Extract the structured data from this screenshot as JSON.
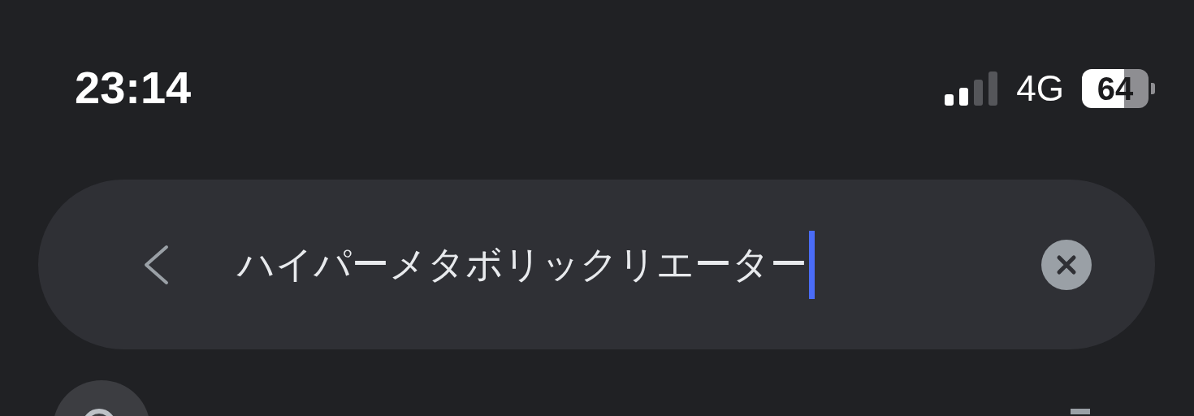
{
  "status_bar": {
    "time": "23:14",
    "network": "4G",
    "battery": "64"
  },
  "search": {
    "value": "ハイパーメタボリックリエーター"
  }
}
